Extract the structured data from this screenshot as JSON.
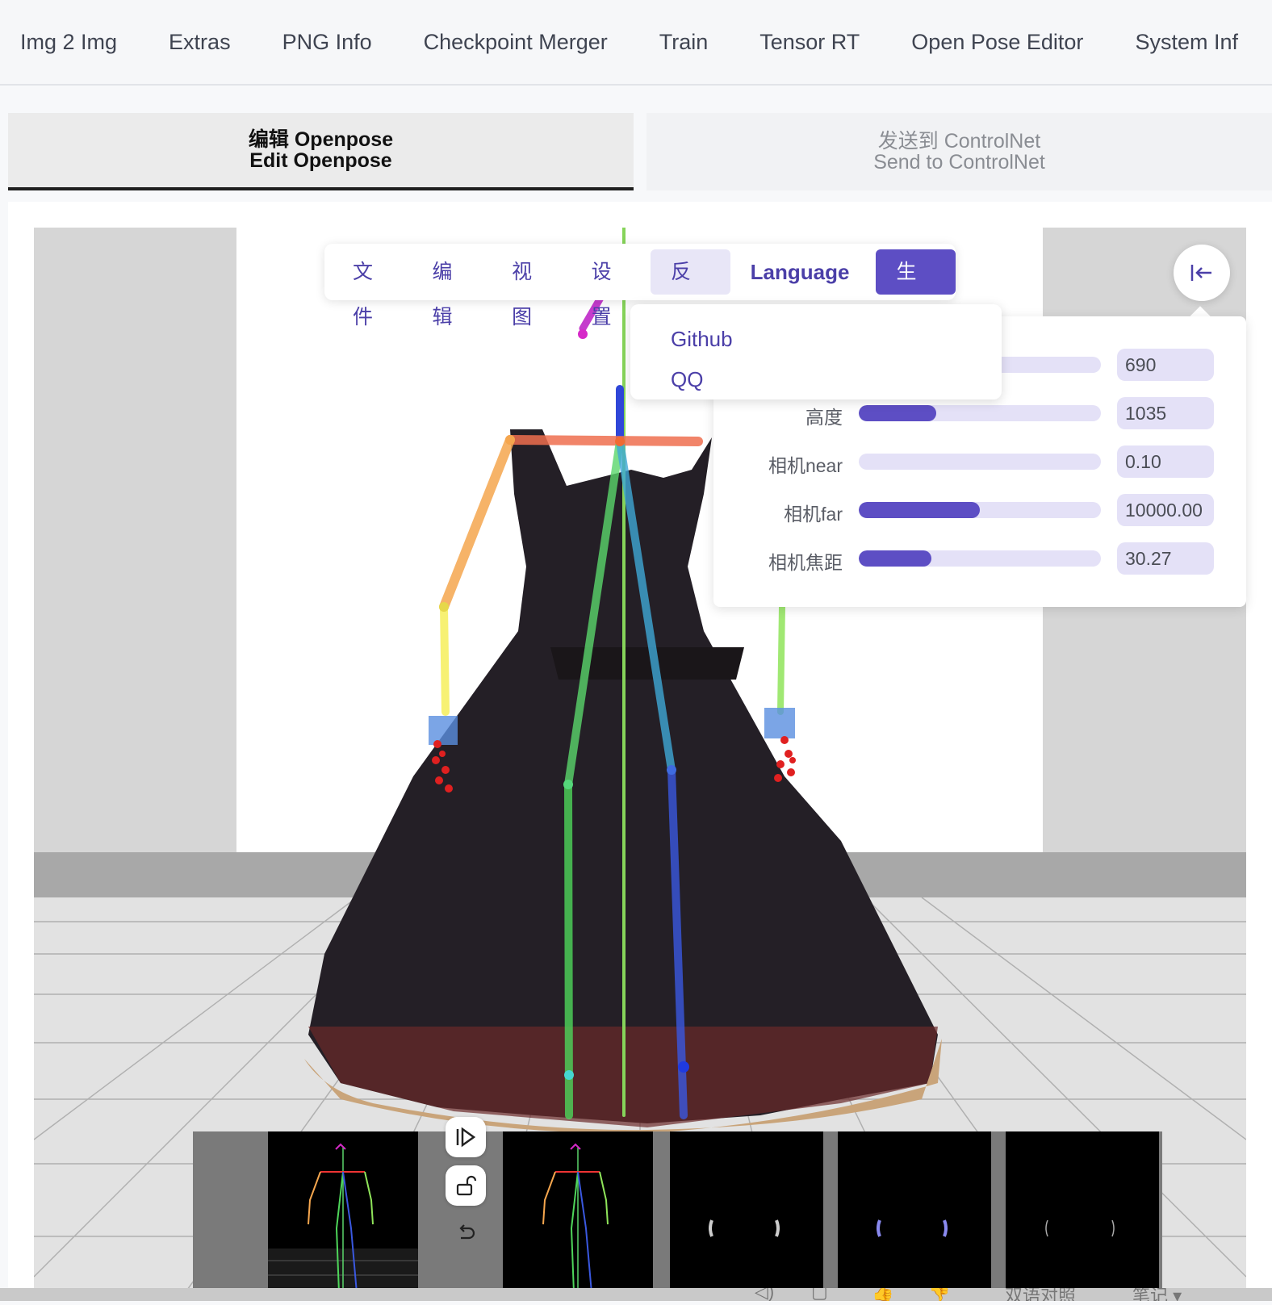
{
  "top_tabs": [
    "Img 2 Img",
    "Extras",
    "PNG Info",
    "Checkpoint Merger",
    "Train",
    "Tensor RT",
    "Open Pose Editor",
    "System Inf"
  ],
  "sub_tabs": {
    "edit": {
      "line1": "编辑 Openpose",
      "line2": "Edit Openpose"
    },
    "send": {
      "line1": "发送到 ControlNet",
      "line2": "Send to ControlNet"
    }
  },
  "menu": {
    "file": "文件",
    "edit": "编辑",
    "view": "视图",
    "settings": "设置",
    "feedback": "反馈",
    "language": "Language",
    "generate": "生成"
  },
  "feedback_menu": [
    "Github",
    "QQ"
  ],
  "settings_panel": {
    "rows": [
      {
        "label": "",
        "value": "690",
        "fill": 0.18
      },
      {
        "label": "高度",
        "value": "1035",
        "fill": 0.32
      },
      {
        "label": "相机near",
        "value": "0.10",
        "fill": 0.0
      },
      {
        "label": "相机far",
        "value": "10000.00",
        "fill": 0.5
      },
      {
        "label": "相机焦距",
        "value": "30.27",
        "fill": 0.3
      }
    ]
  },
  "status_bar": {
    "bilingual": "双语对照",
    "notes": "笔记 ▾"
  },
  "colors": {
    "accent": "#5d4ec4",
    "accent_light": "#e4e1f7"
  }
}
